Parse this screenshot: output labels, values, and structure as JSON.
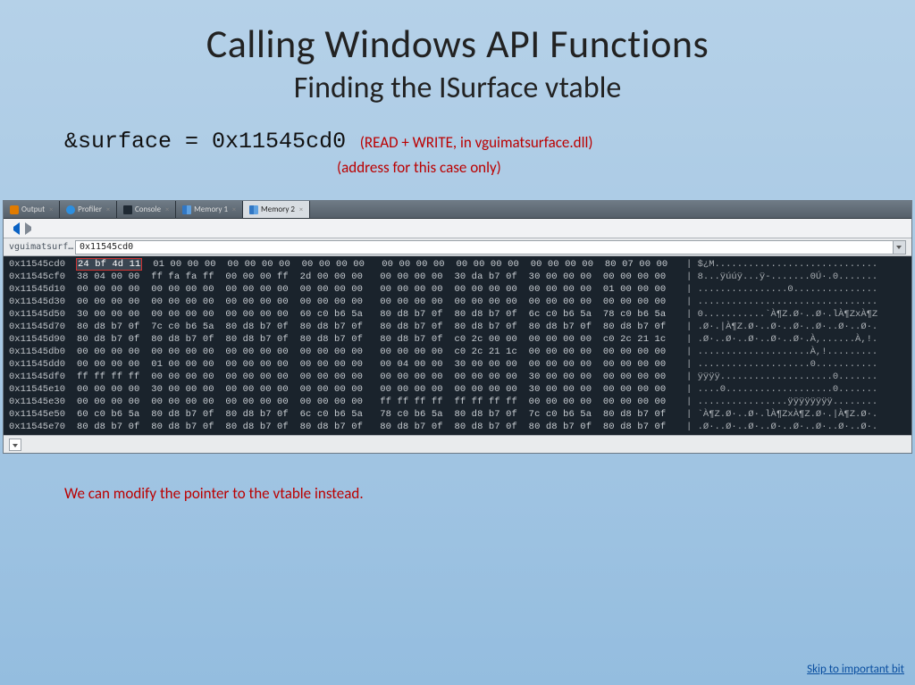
{
  "slide": {
    "title": "Calling Windows API Functions",
    "subtitle": "Finding the ISurface vtable",
    "code_lhs": "&surface",
    "code_eq": " = ",
    "code_rhs": "0x11545cd0",
    "paren1": "(READ + WRITE, in vguimatsurface.dll)",
    "paren2": "(address for this case only)",
    "bottom_note": "We can modify the pointer to the vtable instead.",
    "skip_link": "Skip to important bit"
  },
  "debugger": {
    "tabs": {
      "output": "Output",
      "profiler": "Profiler",
      "console": "Console",
      "memory1": "Memory 1",
      "memory2": "Memory 2"
    },
    "address_label": "vguimatsurf…",
    "address_value": "0x11545cd0",
    "rows": [
      {
        "addr": "0x11545cd0",
        "hl": "24 bf 4d 11",
        "bytes": "  01 00 00 00  00 00 00 00  00 00 00 00   00 00 00 00  00 00 00 00  00 00 00 00  80 07 00 00",
        "ascii": "| $¿M............................."
      },
      {
        "addr": "0x11545cf0",
        "hl": "",
        "bytes": "38 04 00 00  ff fa fa ff  00 00 00 ff  2d 00 00 00   00 00 00 00  30 da b7 0f  30 00 00 00  00 00 00 00",
        "ascii": "| 8...ÿúúÿ...ÿ-.......0Ú·.0......."
      },
      {
        "addr": "0x11545d10",
        "hl": "",
        "bytes": "00 00 00 00  00 00 00 00  00 00 00 00  00 00 00 00   00 00 00 00  00 00 00 00  00 00 00 00  01 00 00 00",
        "ascii": "| ................0..............."
      },
      {
        "addr": "0x11545d30",
        "hl": "",
        "bytes": "00 00 00 00  00 00 00 00  00 00 00 00  00 00 00 00   00 00 00 00  00 00 00 00  00 00 00 00  00 00 00 00",
        "ascii": "| ................................"
      },
      {
        "addr": "0x11545d50",
        "hl": "",
        "bytes": "30 00 00 00  00 00 00 00  00 00 00 00  60 c0 b6 5a   80 d8 b7 0f  80 d8 b7 0f  6c c0 b6 5a  78 c0 b6 5a",
        "ascii": "| 0...........`À¶Z.Ø·..Ø·.lÀ¶ZxÀ¶Z"
      },
      {
        "addr": "0x11545d70",
        "hl": "",
        "bytes": "80 d8 b7 0f  7c c0 b6 5a  80 d8 b7 0f  80 d8 b7 0f   80 d8 b7 0f  80 d8 b7 0f  80 d8 b7 0f  80 d8 b7 0f",
        "ascii": "| .Ø·.|À¶Z.Ø·..Ø·..Ø·..Ø·..Ø·..Ø·."
      },
      {
        "addr": "0x11545d90",
        "hl": "",
        "bytes": "80 d8 b7 0f  80 d8 b7 0f  80 d8 b7 0f  80 d8 b7 0f   80 d8 b7 0f  c0 2c 00 00  00 00 00 00  c0 2c 21 1c",
        "ascii": "| .Ø·..Ø·..Ø·..Ø·..Ø·.À,......À,!."
      },
      {
        "addr": "0x11545db0",
        "hl": "",
        "bytes": "00 00 00 00  00 00 00 00  00 00 00 00  00 00 00 00   00 00 00 00  c0 2c 21 1c  00 00 00 00  00 00 00 00",
        "ascii": "| ....................À,!........."
      },
      {
        "addr": "0x11545dd0",
        "hl": "",
        "bytes": "00 00 00 00  01 00 00 00  00 00 00 00  00 00 00 00   00 04 00 00  30 00 00 00  00 00 00 00  00 00 00 00",
        "ascii": "| ....................0..........."
      },
      {
        "addr": "0x11545df0",
        "hl": "",
        "bytes": "ff ff ff ff  00 00 00 00  00 00 00 00  00 00 00 00   00 00 00 00  00 00 00 00  30 00 00 00  00 00 00 00",
        "ascii": "| ÿÿÿÿ....................0......."
      },
      {
        "addr": "0x11545e10",
        "hl": "",
        "bytes": "00 00 00 00  30 00 00 00  00 00 00 00  00 00 00 00   00 00 00 00  00 00 00 00  30 00 00 00  00 00 00 00",
        "ascii": "| ....0...................0......."
      },
      {
        "addr": "0x11545e30",
        "hl": "",
        "bytes": "00 00 00 00  00 00 00 00  00 00 00 00  00 00 00 00   ff ff ff ff  ff ff ff ff  00 00 00 00  00 00 00 00",
        "ascii": "| ................ÿÿÿÿÿÿÿÿ........"
      },
      {
        "addr": "0x11545e50",
        "hl": "",
        "bytes": "60 c0 b6 5a  80 d8 b7 0f  80 d8 b7 0f  6c c0 b6 5a   78 c0 b6 5a  80 d8 b7 0f  7c c0 b6 5a  80 d8 b7 0f",
        "ascii": "| `À¶Z.Ø·..Ø·.lÀ¶ZxÀ¶Z.Ø·.|À¶Z.Ø·."
      },
      {
        "addr": "0x11545e70",
        "hl": "",
        "bytes": "80 d8 b7 0f  80 d8 b7 0f  80 d8 b7 0f  80 d8 b7 0f   80 d8 b7 0f  80 d8 b7 0f  80 d8 b7 0f  80 d8 b7 0f",
        "ascii": "| .Ø·..Ø·..Ø·..Ø·..Ø·..Ø·..Ø·..Ø·."
      }
    ]
  }
}
